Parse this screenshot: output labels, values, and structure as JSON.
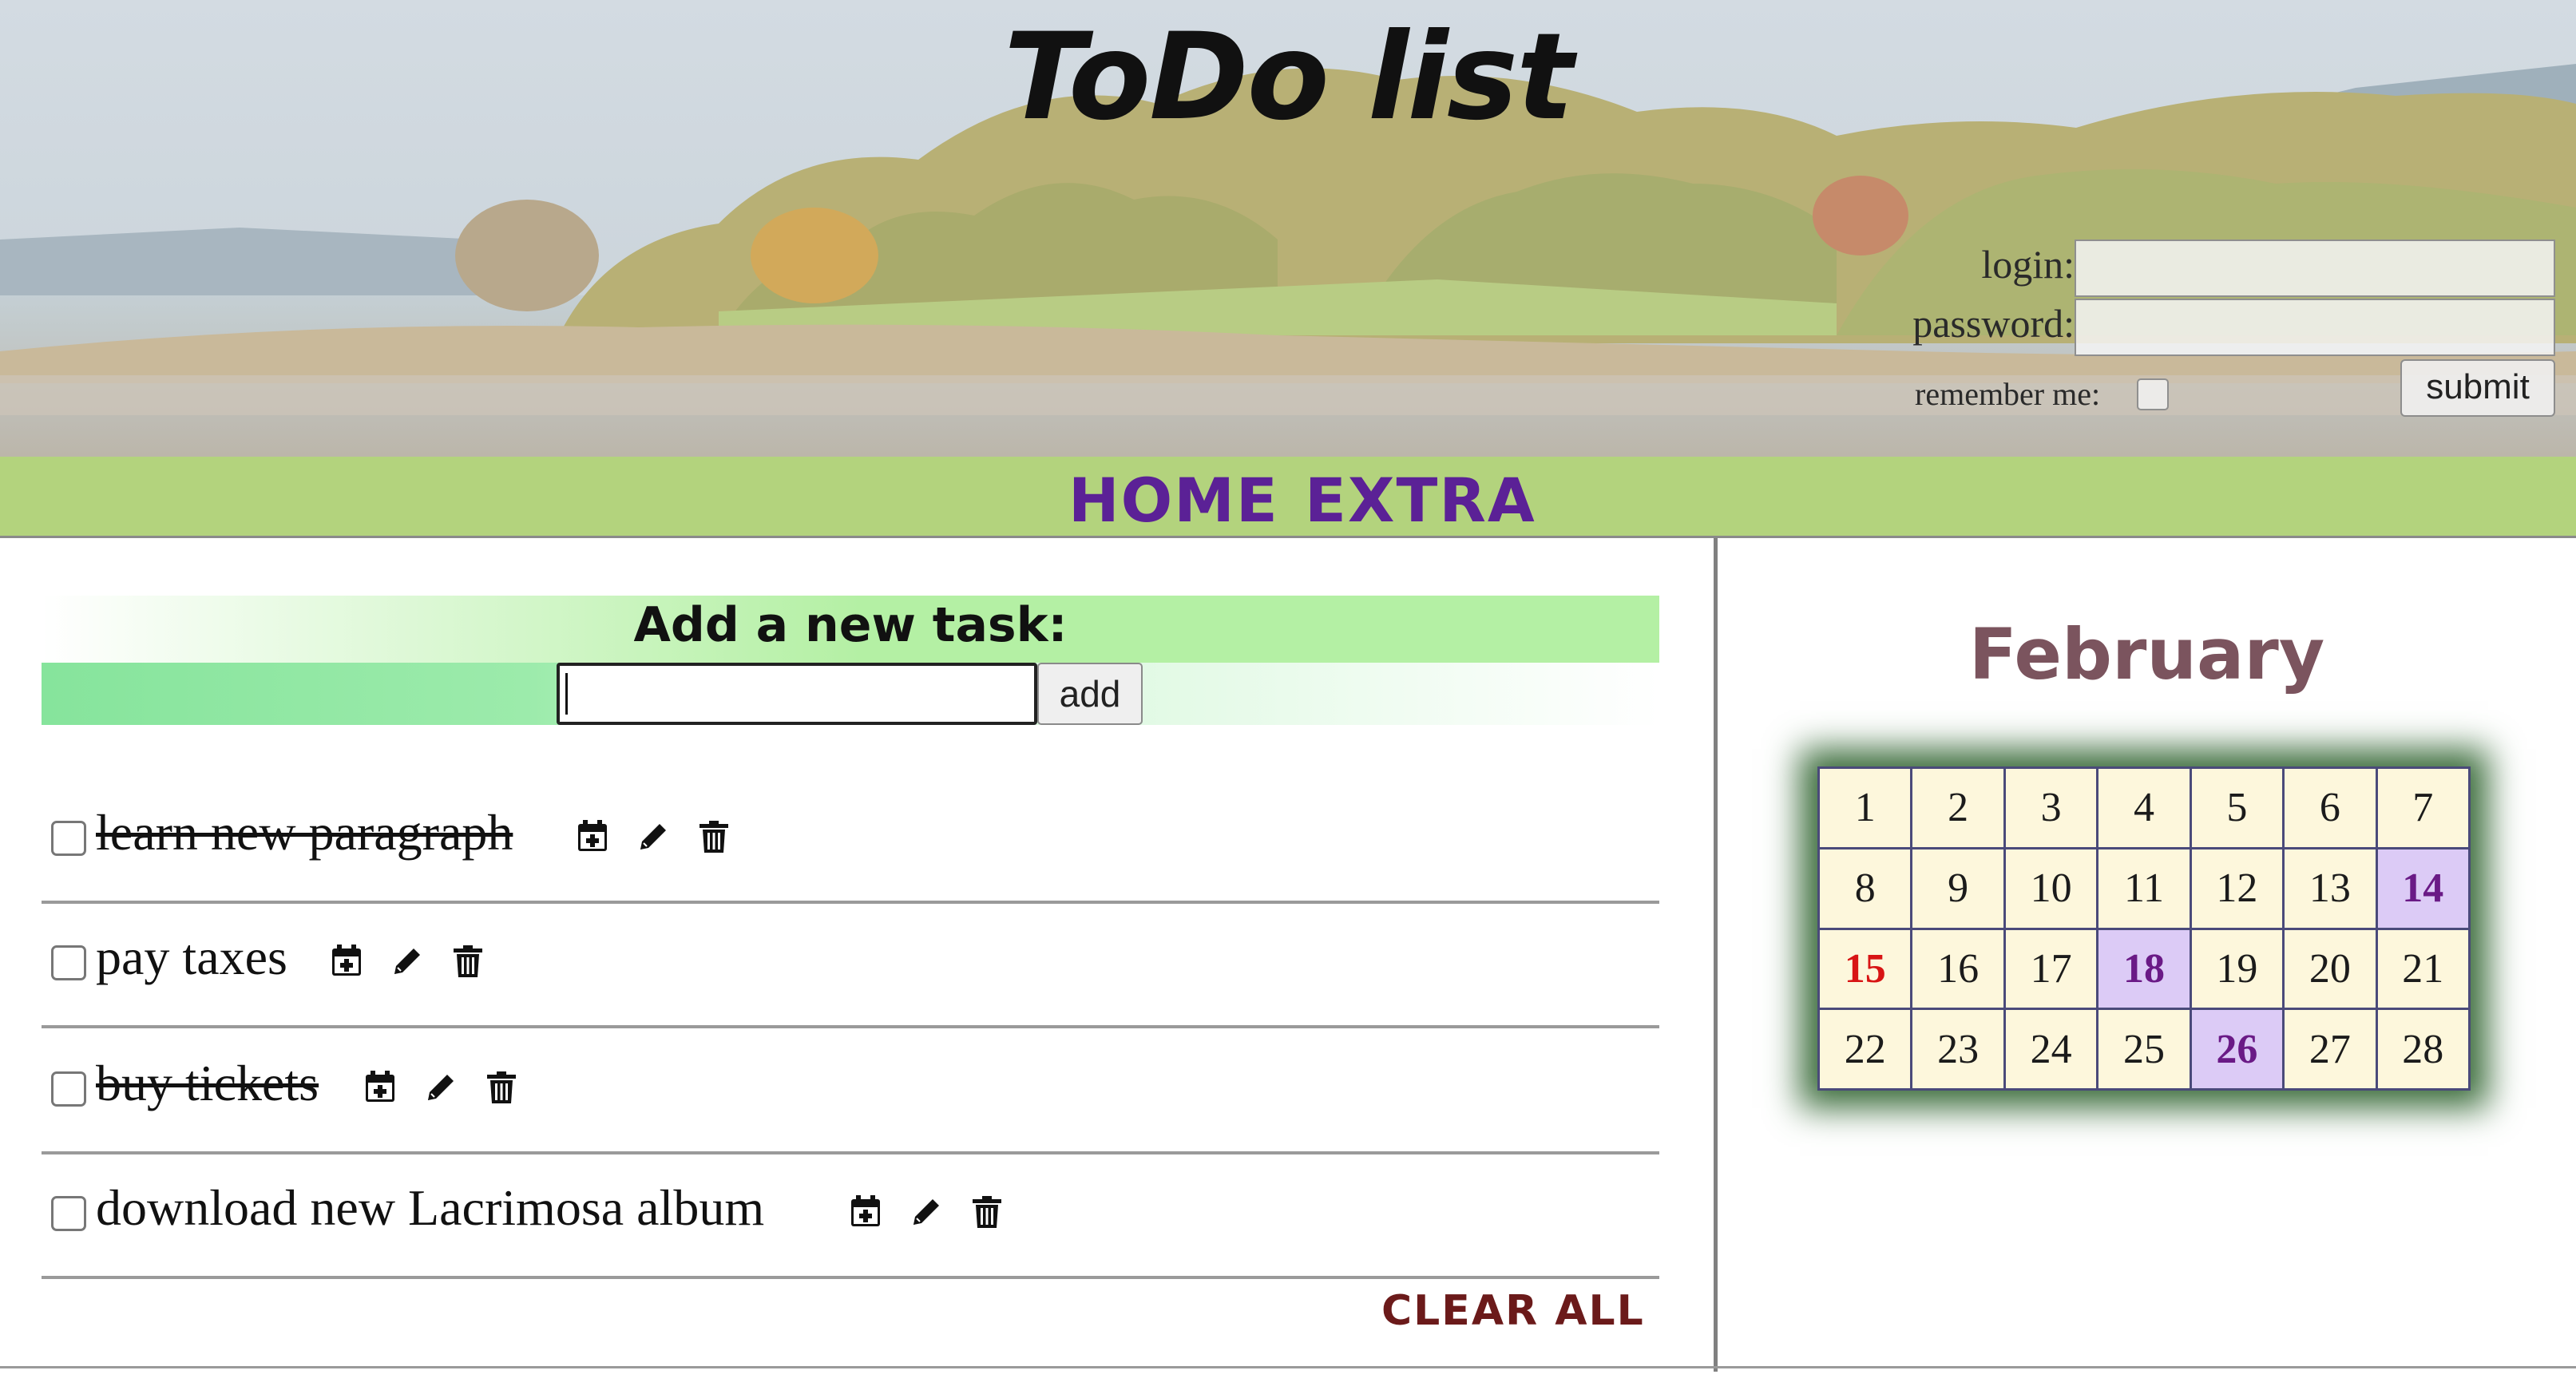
{
  "header": {
    "title": "ToDo list",
    "login": {
      "login_label": "login:",
      "login_value": "",
      "password_label": "password:",
      "password_value": "",
      "remember_label": "remember me:",
      "remember_checked": false,
      "submit_label": "submit"
    }
  },
  "nav": {
    "items": [
      {
        "label": "HOME"
      },
      {
        "label": "EXTRA"
      }
    ]
  },
  "add_task": {
    "title": "Add a new task:",
    "input_value": "",
    "button_label": "add"
  },
  "tasks": [
    {
      "text": "learn new paragraph",
      "done": true,
      "checked": false
    },
    {
      "text": "pay taxes",
      "done": false,
      "checked": false
    },
    {
      "text": "buy tickets",
      "done": true,
      "checked": false
    },
    {
      "text": "download new Lacrimosa album",
      "done": false,
      "checked": false
    }
  ],
  "task_icons": [
    "calendar-plus-icon",
    "pencil-icon",
    "trash-icon"
  ],
  "clear_all_label": "CLEAR ALL",
  "calendar": {
    "month": "February",
    "days": [
      {
        "d": "1"
      },
      {
        "d": "2"
      },
      {
        "d": "3"
      },
      {
        "d": "4"
      },
      {
        "d": "5"
      },
      {
        "d": "6"
      },
      {
        "d": "7"
      },
      {
        "d": "8"
      },
      {
        "d": "9"
      },
      {
        "d": "10"
      },
      {
        "d": "11"
      },
      {
        "d": "12"
      },
      {
        "d": "13"
      },
      {
        "d": "14",
        "mark": true
      },
      {
        "d": "15",
        "today": true
      },
      {
        "d": "16"
      },
      {
        "d": "17"
      },
      {
        "d": "18",
        "mark": true
      },
      {
        "d": "19"
      },
      {
        "d": "20"
      },
      {
        "d": "21"
      },
      {
        "d": "22"
      },
      {
        "d": "23"
      },
      {
        "d": "24"
      },
      {
        "d": "25"
      },
      {
        "d": "26",
        "mark": true
      },
      {
        "d": "27"
      },
      {
        "d": "28"
      }
    ]
  },
  "colors": {
    "nav_bg": "#b3d37d",
    "nav_text": "#5b2196",
    "month_text": "#7b545e",
    "marked_day_bg": "#dccbf6",
    "marked_day_text": "#6a1a86",
    "today_text": "#d81414",
    "clear_all_text": "#6b1a1a",
    "calendar_glow": "#3d6e3d"
  }
}
